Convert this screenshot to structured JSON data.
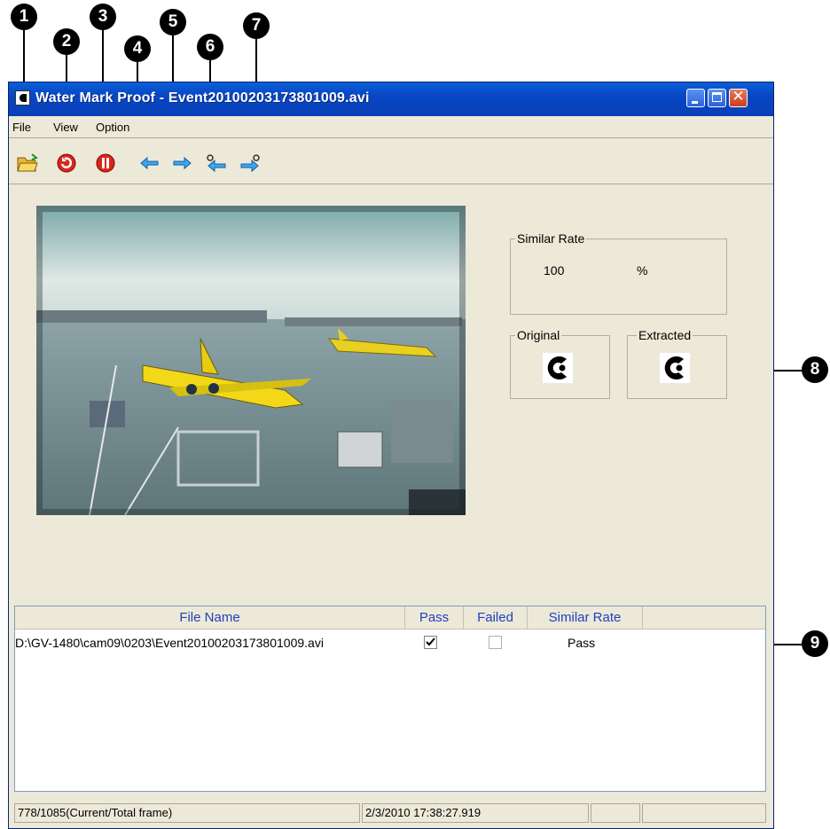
{
  "callouts": [
    "1",
    "2",
    "3",
    "4",
    "5",
    "6",
    "7",
    "8",
    "9"
  ],
  "window": {
    "title": "Water Mark Proof - Event20100203173801009.avi",
    "controls": {
      "close": "✕"
    }
  },
  "menu": [
    "File",
    "View",
    "Option"
  ],
  "toolbar_icons": [
    "open-folder-icon",
    "play-icon",
    "pause-icon",
    "prev-frame-icon",
    "next-frame-icon",
    "prev-event-icon",
    "next-event-icon"
  ],
  "similar_rate": {
    "label": "Similar Rate",
    "value": "100",
    "unit": "%"
  },
  "original": {
    "label": "Original"
  },
  "extracted": {
    "label": "Extracted"
  },
  "list": {
    "columns": [
      "File Name",
      "Pass",
      "Failed",
      "Similar Rate"
    ],
    "rows": [
      {
        "file": "D:\\GV-1480\\cam09\\0203\\Event20100203173801009.avi",
        "pass": true,
        "failed": false,
        "rate": "Pass"
      }
    ]
  },
  "status": {
    "frame": "778/1085(Current/Total frame)",
    "time": "2/3/2010 17:38:27.919"
  },
  "colors": {
    "titlebar": "#0846c4",
    "window": "#ece9d8",
    "header_text": "#2040c0"
  }
}
